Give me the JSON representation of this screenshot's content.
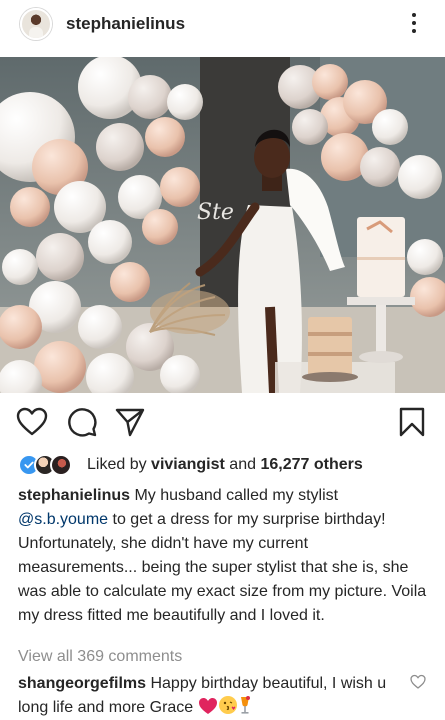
{
  "post": {
    "username": "stephanielinus",
    "cake_text": "Ste"
  },
  "likes": {
    "prefix": "Liked by ",
    "first_liker": "viviangist",
    "middle": " and ",
    "others": "16,277 others"
  },
  "caption": {
    "author": "stephanielinus",
    "text_before": " My husband called my stylist ",
    "mention": "@s.b.youme",
    "text_after": " to get a dress for my surprise birthday! Unfortunately, she didn't have my current measurements... being the super stylist that she is, she was able to calculate my exact size from my picture. Voila my dress fitted me beautifully and I loved it."
  },
  "comments": {
    "view_all": "View all 369 comments",
    "items": [
      {
        "author": "shangeorgefilms",
        "text": " Happy birthday beautiful, I wish u long life and more Grace "
      }
    ]
  },
  "icons": {
    "header": [
      "avatar",
      "more-icon"
    ],
    "actions": [
      "heart-icon",
      "comment-icon",
      "share-icon",
      "bookmark-icon"
    ]
  },
  "colors": {
    "text": "#262626",
    "muted": "#8e8e8e",
    "mention": "#00376b",
    "verified": "#3897f0"
  }
}
